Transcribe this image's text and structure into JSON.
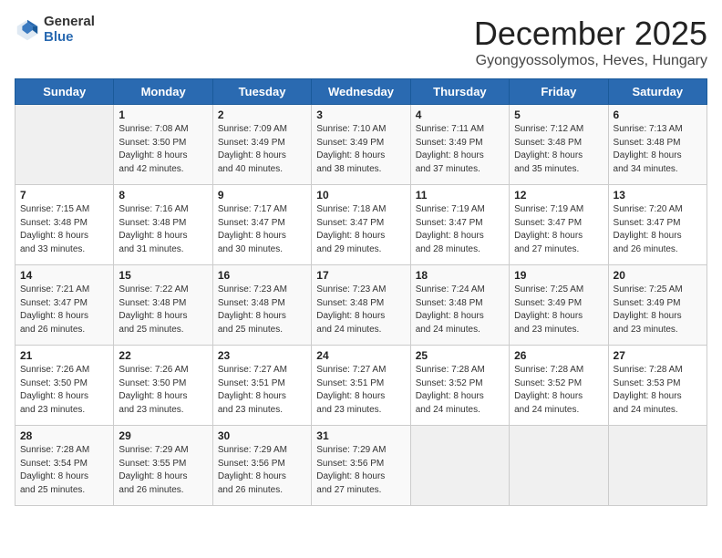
{
  "logo": {
    "general": "General",
    "blue": "Blue"
  },
  "header": {
    "month": "December 2025",
    "location": "Gyongyossolymos, Heves, Hungary"
  },
  "weekdays": [
    "Sunday",
    "Monday",
    "Tuesday",
    "Wednesday",
    "Thursday",
    "Friday",
    "Saturday"
  ],
  "weeks": [
    [
      {
        "day": "",
        "content": ""
      },
      {
        "day": "1",
        "content": "Sunrise: 7:08 AM\nSunset: 3:50 PM\nDaylight: 8 hours\nand 42 minutes."
      },
      {
        "day": "2",
        "content": "Sunrise: 7:09 AM\nSunset: 3:49 PM\nDaylight: 8 hours\nand 40 minutes."
      },
      {
        "day": "3",
        "content": "Sunrise: 7:10 AM\nSunset: 3:49 PM\nDaylight: 8 hours\nand 38 minutes."
      },
      {
        "day": "4",
        "content": "Sunrise: 7:11 AM\nSunset: 3:49 PM\nDaylight: 8 hours\nand 37 minutes."
      },
      {
        "day": "5",
        "content": "Sunrise: 7:12 AM\nSunset: 3:48 PM\nDaylight: 8 hours\nand 35 minutes."
      },
      {
        "day": "6",
        "content": "Sunrise: 7:13 AM\nSunset: 3:48 PM\nDaylight: 8 hours\nand 34 minutes."
      }
    ],
    [
      {
        "day": "7",
        "content": "Sunrise: 7:15 AM\nSunset: 3:48 PM\nDaylight: 8 hours\nand 33 minutes."
      },
      {
        "day": "8",
        "content": "Sunrise: 7:16 AM\nSunset: 3:48 PM\nDaylight: 8 hours\nand 31 minutes."
      },
      {
        "day": "9",
        "content": "Sunrise: 7:17 AM\nSunset: 3:47 PM\nDaylight: 8 hours\nand 30 minutes."
      },
      {
        "day": "10",
        "content": "Sunrise: 7:18 AM\nSunset: 3:47 PM\nDaylight: 8 hours\nand 29 minutes."
      },
      {
        "day": "11",
        "content": "Sunrise: 7:19 AM\nSunset: 3:47 PM\nDaylight: 8 hours\nand 28 minutes."
      },
      {
        "day": "12",
        "content": "Sunrise: 7:19 AM\nSunset: 3:47 PM\nDaylight: 8 hours\nand 27 minutes."
      },
      {
        "day": "13",
        "content": "Sunrise: 7:20 AM\nSunset: 3:47 PM\nDaylight: 8 hours\nand 26 minutes."
      }
    ],
    [
      {
        "day": "14",
        "content": "Sunrise: 7:21 AM\nSunset: 3:47 PM\nDaylight: 8 hours\nand 26 minutes."
      },
      {
        "day": "15",
        "content": "Sunrise: 7:22 AM\nSunset: 3:48 PM\nDaylight: 8 hours\nand 25 minutes."
      },
      {
        "day": "16",
        "content": "Sunrise: 7:23 AM\nSunset: 3:48 PM\nDaylight: 8 hours\nand 25 minutes."
      },
      {
        "day": "17",
        "content": "Sunrise: 7:23 AM\nSunset: 3:48 PM\nDaylight: 8 hours\nand 24 minutes."
      },
      {
        "day": "18",
        "content": "Sunrise: 7:24 AM\nSunset: 3:48 PM\nDaylight: 8 hours\nand 24 minutes."
      },
      {
        "day": "19",
        "content": "Sunrise: 7:25 AM\nSunset: 3:49 PM\nDaylight: 8 hours\nand 23 minutes."
      },
      {
        "day": "20",
        "content": "Sunrise: 7:25 AM\nSunset: 3:49 PM\nDaylight: 8 hours\nand 23 minutes."
      }
    ],
    [
      {
        "day": "21",
        "content": "Sunrise: 7:26 AM\nSunset: 3:50 PM\nDaylight: 8 hours\nand 23 minutes."
      },
      {
        "day": "22",
        "content": "Sunrise: 7:26 AM\nSunset: 3:50 PM\nDaylight: 8 hours\nand 23 minutes."
      },
      {
        "day": "23",
        "content": "Sunrise: 7:27 AM\nSunset: 3:51 PM\nDaylight: 8 hours\nand 23 minutes."
      },
      {
        "day": "24",
        "content": "Sunrise: 7:27 AM\nSunset: 3:51 PM\nDaylight: 8 hours\nand 23 minutes."
      },
      {
        "day": "25",
        "content": "Sunrise: 7:28 AM\nSunset: 3:52 PM\nDaylight: 8 hours\nand 24 minutes."
      },
      {
        "day": "26",
        "content": "Sunrise: 7:28 AM\nSunset: 3:52 PM\nDaylight: 8 hours\nand 24 minutes."
      },
      {
        "day": "27",
        "content": "Sunrise: 7:28 AM\nSunset: 3:53 PM\nDaylight: 8 hours\nand 24 minutes."
      }
    ],
    [
      {
        "day": "28",
        "content": "Sunrise: 7:28 AM\nSunset: 3:54 PM\nDaylight: 8 hours\nand 25 minutes."
      },
      {
        "day": "29",
        "content": "Sunrise: 7:29 AM\nSunset: 3:55 PM\nDaylight: 8 hours\nand 26 minutes."
      },
      {
        "day": "30",
        "content": "Sunrise: 7:29 AM\nSunset: 3:56 PM\nDaylight: 8 hours\nand 26 minutes."
      },
      {
        "day": "31",
        "content": "Sunrise: 7:29 AM\nSunset: 3:56 PM\nDaylight: 8 hours\nand 27 minutes."
      },
      {
        "day": "",
        "content": ""
      },
      {
        "day": "",
        "content": ""
      },
      {
        "day": "",
        "content": ""
      }
    ]
  ]
}
